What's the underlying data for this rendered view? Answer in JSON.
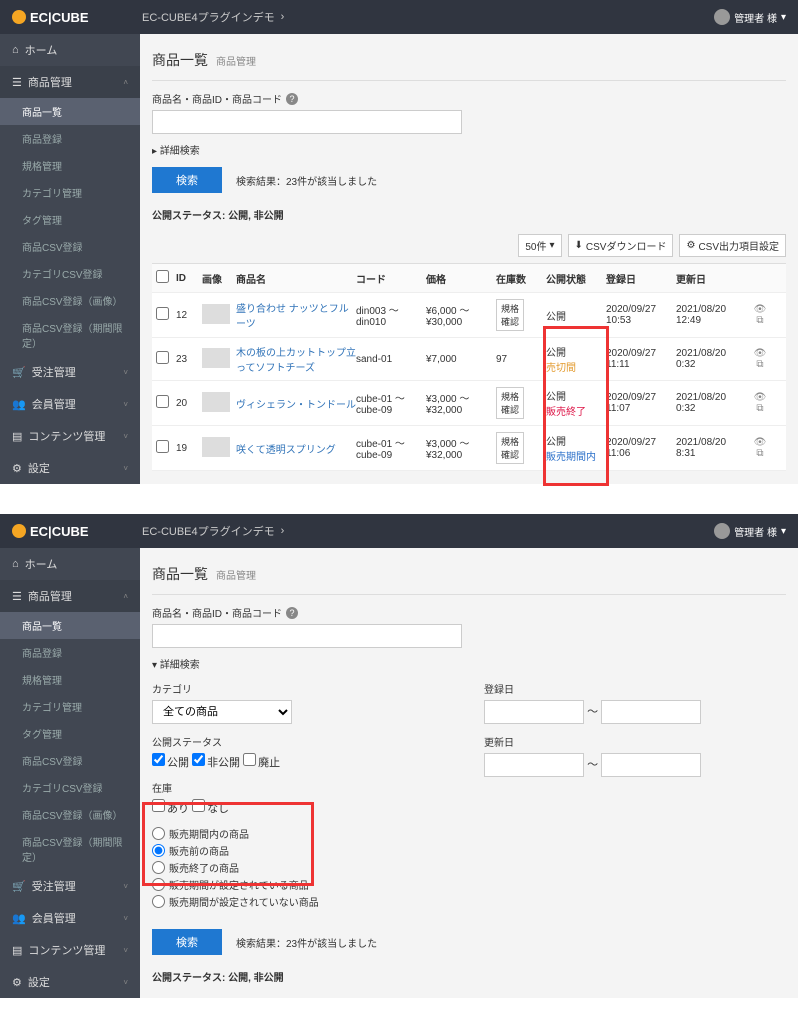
{
  "brand": "EC|CUBE",
  "breadcrumb": "EC-CUBE4プラグインデモ",
  "user_top": "管理者 様",
  "user_bot": "管理者 様",
  "sidebar_top": {
    "home": "ホーム",
    "prod": "商品管理",
    "sub": [
      "商品一覧",
      "商品登録",
      "規格管理",
      "カテゴリ管理",
      "タグ管理",
      "商品CSV登録",
      "カテゴリCSV登録",
      "商品CSV登録（画像）",
      "商品CSV登録（期間限定）"
    ],
    "order": "受注管理",
    "member": "会員管理",
    "content": "コンテンツ管理",
    "setting": "設定"
  },
  "sidebar_bot": {
    "home": "ホーム",
    "prod": "商品管理",
    "sub": [
      "商品一覧",
      "商品登録",
      "規格管理",
      "カテゴリ管理",
      "タグ管理",
      "商品CSV登録",
      "カテゴリCSV登録",
      "商品CSV登録（画像）",
      "商品CSV登録（期間限定）"
    ],
    "order": "受注管理",
    "member": "会員管理",
    "content": "コンテンツ管理",
    "setting": "設定"
  },
  "top": {
    "title": "商品一覧",
    "title_sub": "商品管理",
    "search_lbl": "商品名・商品ID・商品コード",
    "adv": "詳細検索",
    "btn": "検索",
    "result": "検索結果：23件が該当しました",
    "status": "公開ステータス: 公開, 非公開",
    "per": "50件",
    "csv_dl": "CSVダウンロード",
    "csv_cfg": "CSV出力項目設定",
    "cols": {
      "id": "ID",
      "img": "画像",
      "name": "商品名",
      "code": "コード",
      "price": "価格",
      "stock": "在庫数",
      "stat": "公開状態",
      "reg": "登録日",
      "upd": "更新日"
    },
    "rows": [
      {
        "id": "12",
        "name": "盛り合わせ ナッツとフルーツ",
        "code": "din003 ～ din010",
        "price": "¥6,000 ～ ¥30,000",
        "stock": "規格\n確認",
        "stat1": "公開",
        "stat2": "",
        "reg": "2020/09/27 10:53",
        "upd": "2021/08/20 12:49"
      },
      {
        "id": "23",
        "name": "木の板の上カットトップ立ってソフトチーズ",
        "code": "sand-01",
        "price": "¥7,000",
        "stock": "97",
        "stat1": "公開",
        "stat2": "売切間",
        "reg": "2020/09/27 11:11",
        "upd": "2021/08/20 0:32"
      },
      {
        "id": "20",
        "name": "ヴィシェラン・トンドール",
        "code": "cube-01 ～ cube-09",
        "price": "¥3,000 ～ ¥32,000",
        "stock": "規格\n確認",
        "stat1": "公開",
        "stat2": "販売終了",
        "reg": "2020/09/27 11:07",
        "upd": "2021/08/20 0:32"
      },
      {
        "id": "19",
        "name": "咲くて透明スプリング",
        "code": "cube-01 ～ cube-09",
        "price": "¥3,000 ～ ¥32,000",
        "stock": "規格\n確認",
        "stat1": "公開",
        "stat2": "販売期間内",
        "reg": "2020/09/27 11:06",
        "upd": "2021/08/20 8:31"
      }
    ]
  },
  "bot": {
    "title": "商品一覧",
    "title_sub": "商品管理",
    "search_lbl": "商品名・商品ID・商品コード",
    "adv": "詳細検索",
    "cat_lbl": "カテゴリ",
    "cat_val": "全ての商品",
    "reg_lbl": "登録日",
    "upd_lbl": "更新日",
    "tilde": "～",
    "ps_lbl": "公開ステータス",
    "ps_1": "公開",
    "ps_2": "非公開",
    "ps_3": "廃止",
    "stock_lbl": "在庫",
    "stock_1": "あり",
    "stock_2": "なし",
    "radios": [
      "販売期間内の商品",
      "販売前の商品",
      "販売終了の商品",
      "販売期間が設定されている商品",
      "販売期間が設定されていない商品"
    ],
    "btn": "検索",
    "result": "検索結果：23件が該当しました",
    "status": "公開ステータス: 公開, 非公開"
  }
}
